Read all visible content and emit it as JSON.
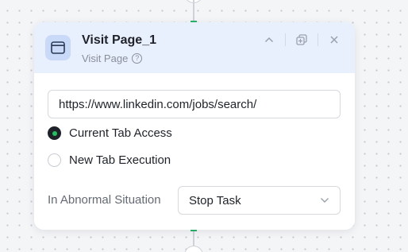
{
  "node": {
    "title": "Visit Page_1",
    "subtitle": "Visit Page",
    "help_glyph": "?",
    "icon": "browser-window-icon"
  },
  "header_actions": [
    "collapse-chevron-up-icon",
    "copy-icon",
    "close-icon"
  ],
  "url_field": {
    "value": "https://www.linkedin.com/jobs/search/"
  },
  "tab_mode": {
    "options": [
      {
        "label": "Current Tab Access",
        "checked": true
      },
      {
        "label": "New Tab Execution",
        "checked": false
      }
    ]
  },
  "abnormal": {
    "label": "In Abnormal Situation",
    "selected": "Stop Task"
  },
  "colors": {
    "header_bg": "#e8effd",
    "icon_bg": "#c9daf8",
    "radio_selected": "#21c35d",
    "connector_accent": "#29b36b"
  }
}
